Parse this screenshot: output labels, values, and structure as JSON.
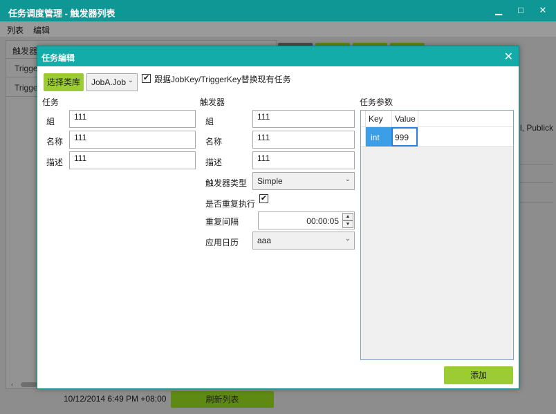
{
  "window": {
    "title": "任务调度管理 - 触发器列表",
    "minimize_glyph": "▁",
    "maximize_glyph": "□",
    "close_glyph": "✕"
  },
  "menu": {
    "items": [
      "列表",
      "编辑"
    ]
  },
  "background": {
    "grid_header": "触发器",
    "rows": [
      "Trigge",
      "Trigge"
    ],
    "right_text": "l, Publick",
    "status_date": "10/12/2014 6:49 PM +08:00",
    "refresh_button": "刷新列表",
    "scroll_left_glyph": "‹"
  },
  "dialog": {
    "title": "任务编辑",
    "close_glyph": "✕",
    "select_lib_button": "选择类库",
    "job_class": "JobA.Job",
    "replace_checkbox_label": "跟据JobKey/TriggerKey替换现有任务",
    "replace_checked": true,
    "job_section": {
      "title": "任务",
      "group_label": "組",
      "group_value": "111",
      "name_label": "名称",
      "name_value": "111",
      "desc_label": "描述",
      "desc_value": "111"
    },
    "trigger_section": {
      "title": "触发器",
      "group_label": "組",
      "group_value": "111",
      "name_label": "名称",
      "name_value": "111",
      "desc_label": "描述",
      "desc_value": "111",
      "type_label": "触发器类型",
      "type_value": "Simple",
      "repeat_label": "是否重复执行",
      "repeat_checked": true,
      "interval_label": "重复间隔",
      "interval_value": "00:00:05",
      "calendar_label": "应用日历",
      "calendar_value": "aaa"
    },
    "params_section": {
      "title": "任务参数",
      "columns": [
        "Key",
        "Value"
      ],
      "rows": [
        {
          "key": "int",
          "value": "999"
        }
      ]
    },
    "add_button": "添加"
  },
  "colors": {
    "titlebar": "#0f9795",
    "dialog_titlebar": "#13aca9",
    "accent_green": "#9bcc33",
    "selection_blue": "#3d9ee8"
  },
  "icons": {
    "checkmark": "✔",
    "chevron_down": "⌄",
    "spin_up": "▲",
    "spin_down": "▼"
  }
}
